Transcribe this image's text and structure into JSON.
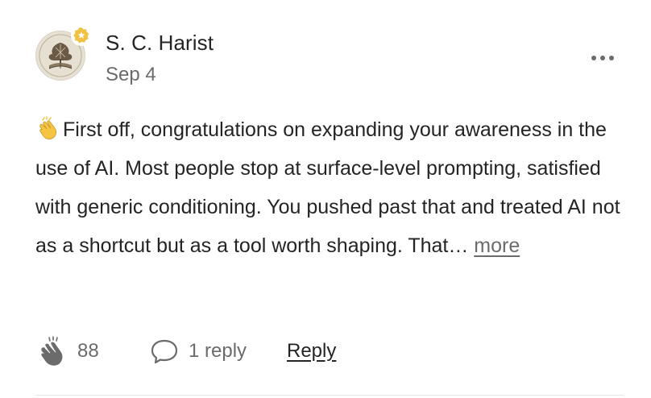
{
  "comment": {
    "author": "S. C. Harist",
    "date": "Sep 4",
    "text": "First off, congratulations on expanding your awareness in the use of AI. Most people stop at surface-level prompting, satisfied with generic conditioning. You pushed past that and treated AI not as a shortcut but as a tool worth shaping. That…",
    "more_label": "more",
    "claps": "88",
    "replies": "1 reply",
    "reply_label": "Reply"
  },
  "icons": {
    "badge": "star-badge-icon",
    "more_options": "ellipsis-icon",
    "clap": "clap-icon",
    "reply": "speech-bubble-icon",
    "emoji": "clapping-hands-emoji"
  },
  "colors": {
    "text": "#242424",
    "muted": "#6b6b6b",
    "badge": "#f2c043",
    "emoji": "#f5c542"
  }
}
